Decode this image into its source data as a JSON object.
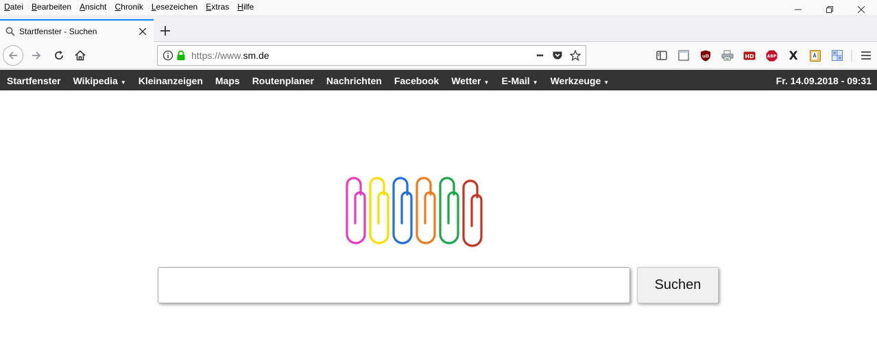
{
  "menubar": {
    "items": [
      "Datei",
      "Bearbeiten",
      "Ansicht",
      "Chronik",
      "Lesezeichen",
      "Extras",
      "Hilfe"
    ]
  },
  "tab": {
    "title": "Startfenster - Suchen"
  },
  "urlbar": {
    "prefix": "https://www.",
    "domain": "sm.de",
    "more": "•••"
  },
  "extensions": {
    "ublock": "uD",
    "hd": "HD",
    "abp": "ABP",
    "x": "X"
  },
  "sitenav": {
    "items": [
      {
        "label": "Startfenster",
        "caret": ""
      },
      {
        "label": "Wikipedia",
        "caret": "▼"
      },
      {
        "label": "Kleinanzeigen",
        "caret": ""
      },
      {
        "label": "Maps",
        "caret": ""
      },
      {
        "label": "Routenplaner",
        "caret": ""
      },
      {
        "label": "Nachrichten",
        "caret": ""
      },
      {
        "label": "Facebook",
        "caret": ""
      },
      {
        "label": "Wetter",
        "caret": "▼"
      },
      {
        "label": "E-Mail",
        "caret": "▼"
      },
      {
        "label": "Werkzeuge",
        "caret": "▼"
      }
    ],
    "datetime": "Fr. 14.09.2018 - 09:31"
  },
  "search": {
    "value": "",
    "button_label": "Suchen"
  },
  "colors": {
    "accent": "#0a84ff",
    "sitenav_bg": "#333333",
    "clips": [
      "#e83bbd",
      "#f5e000",
      "#1f6fe0",
      "#f07a1a",
      "#1aa84a",
      "#c8321e"
    ]
  }
}
